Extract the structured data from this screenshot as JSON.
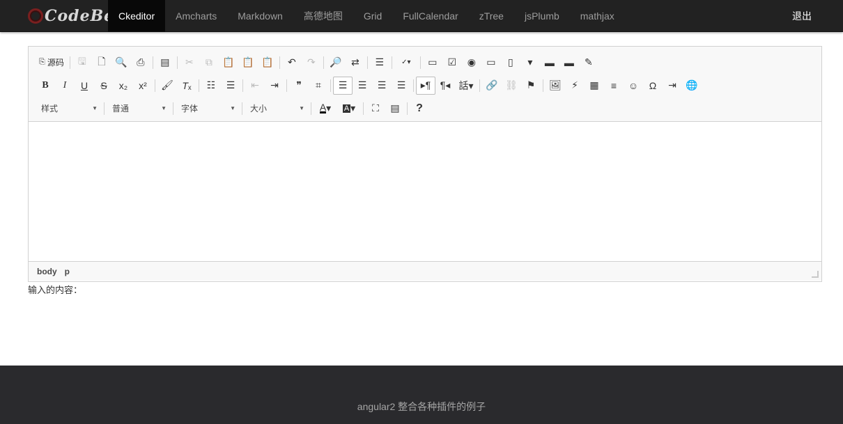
{
  "brand": {
    "name": "CodeBe"
  },
  "nav": {
    "items": [
      {
        "label": "Ckeditor",
        "active": true
      },
      {
        "label": "Amcharts"
      },
      {
        "label": "Markdown"
      },
      {
        "label": "高德地图"
      },
      {
        "label": "Grid"
      },
      {
        "label": "FullCalendar"
      },
      {
        "label": "zTree"
      },
      {
        "label": "jsPlumb"
      },
      {
        "label": "mathjax"
      }
    ],
    "logout": "退出"
  },
  "editor": {
    "source_label": "源码",
    "combos": {
      "style": "样式",
      "format": "普通",
      "font": "字体",
      "size": "大小"
    },
    "path": [
      "body",
      "p"
    ]
  },
  "output_label": "输入的内容：",
  "footer_text": "angular2 整合各种插件的例子"
}
